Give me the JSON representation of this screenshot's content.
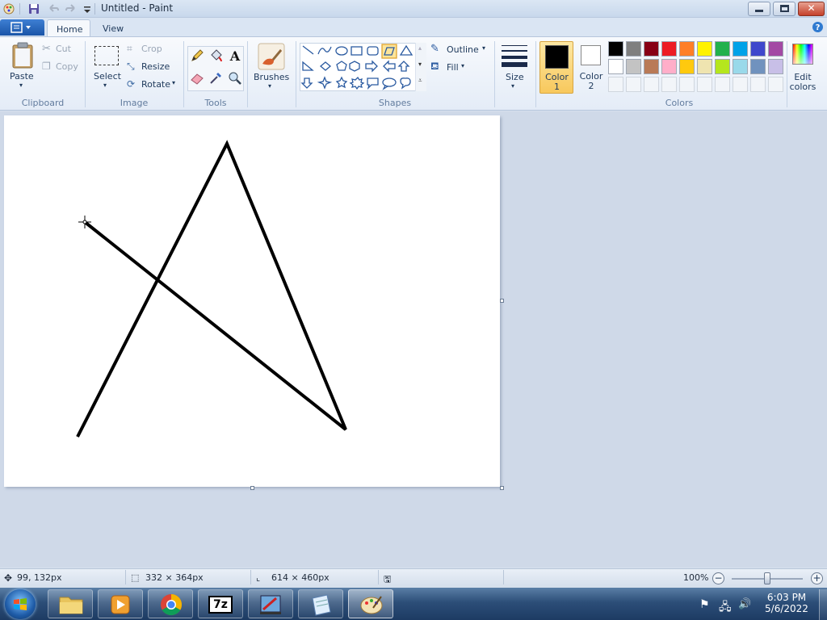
{
  "window": {
    "title": "Untitled - Paint"
  },
  "tabs": [
    {
      "label": "Home"
    },
    {
      "label": "View"
    }
  ],
  "clipboard": {
    "paste": "Paste",
    "cut": "Cut",
    "copy": "Copy",
    "group": "Clipboard"
  },
  "image": {
    "select": "Select",
    "crop": "Crop",
    "resize": "Resize",
    "rotate": "Rotate",
    "group": "Image"
  },
  "tools": {
    "group": "Tools"
  },
  "brushes": {
    "label": "Brushes"
  },
  "shapes": {
    "outline": "Outline",
    "fill": "Fill",
    "group": "Shapes"
  },
  "size": {
    "label": "Size"
  },
  "colors": {
    "color1": {
      "line1": "Color",
      "line2": "1",
      "value": "#000000"
    },
    "color2": {
      "line1": "Color",
      "line2": "2",
      "value": "#ffffff"
    },
    "edit_line1": "Edit",
    "edit_line2": "colors",
    "group": "Colors",
    "row1": [
      "#000000",
      "#7f7f7f",
      "#880015",
      "#ed1c24",
      "#ff7f27",
      "#fff200",
      "#22b14c",
      "#00a2e8",
      "#3f48cc",
      "#a349a4"
    ],
    "row2": [
      "#ffffff",
      "#c3c3c3",
      "#b97a57",
      "#ffaec9",
      "#ffc90e",
      "#efe4b0",
      "#b5e61d",
      "#99d9ea",
      "#7092be",
      "#c8bfe7"
    ]
  },
  "status": {
    "cursor": "99, 132px",
    "selection": "332 × 364px",
    "canvas_size": "614 × 460px",
    "zoom": "100%",
    "zoom_level": 1.0
  },
  "taskbar": {
    "time": "6:03 PM",
    "date": "5/6/2022"
  }
}
